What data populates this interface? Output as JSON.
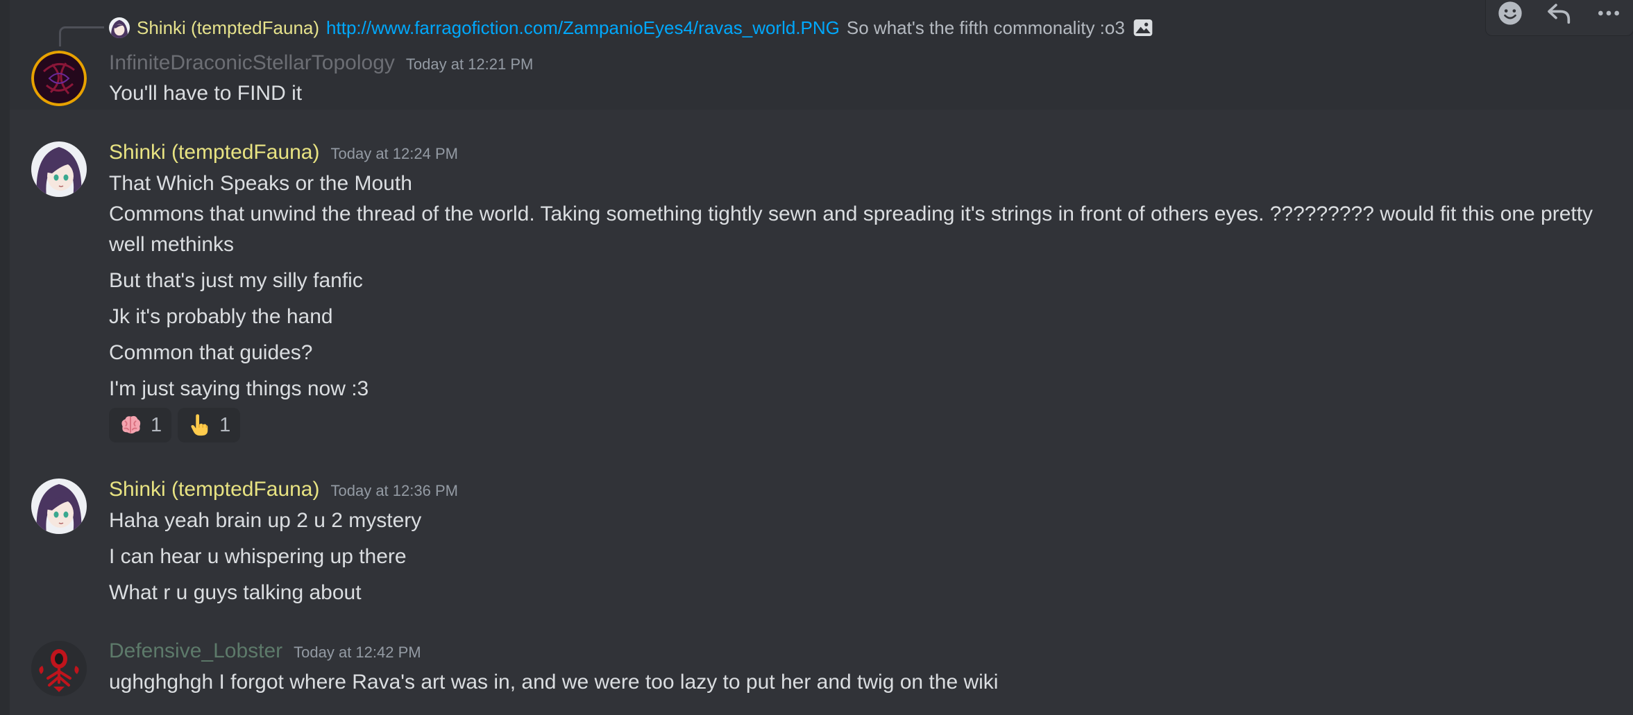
{
  "reply": {
    "author": "Shinki (temptedFauna)",
    "link": "http://www.farragofiction.com/ZampanioEyes4/ravas_world.PNG",
    "text": "So what's the fifth commonality :o3"
  },
  "toolbar": {
    "items": [
      "add-reaction-icon",
      "reply-icon",
      "more-options-icon"
    ]
  },
  "messages": [
    {
      "author": "InfiniteDraconicStellarTopology",
      "author_color": "#6c6e74",
      "timestamp": "Today at 12:21 PM",
      "lines": [
        "You'll have to FIND it"
      ]
    },
    {
      "author": "Shinki (temptedFauna)",
      "author_color": "#e8e382",
      "timestamp": "Today at 12:24 PM",
      "lines": [
        "That Which Speaks or the Mouth",
        "Commons that unwind the thread of the world. Taking something tightly sewn and spreading it's strings in front of others eyes. ????????? would fit this one pretty well methinks",
        "But that's just my silly fanfic",
        "Jk it's probably the hand",
        "Common that guides?",
        "I'm just saying things now :3"
      ],
      "reactions": [
        {
          "emoji": "brain-emoji",
          "count": "1"
        },
        {
          "emoji": "pointing-up-hand-emoji",
          "count": "1"
        }
      ]
    },
    {
      "author": "Shinki (temptedFauna)",
      "author_color": "#e8e382",
      "timestamp": "Today at 12:36 PM",
      "lines": [
        "Haha yeah brain up 2 u 2 mystery",
        "I can hear u whispering up there",
        "What r u guys talking about"
      ]
    },
    {
      "author": "Defensive_Lobster",
      "author_color": "#5d7a6a",
      "timestamp": "Today at 12:42 PM",
      "lines": [
        "ughghghgh I forgot where Rava's art was in, and we were too lazy to put her and twig on the wiki"
      ]
    }
  ]
}
